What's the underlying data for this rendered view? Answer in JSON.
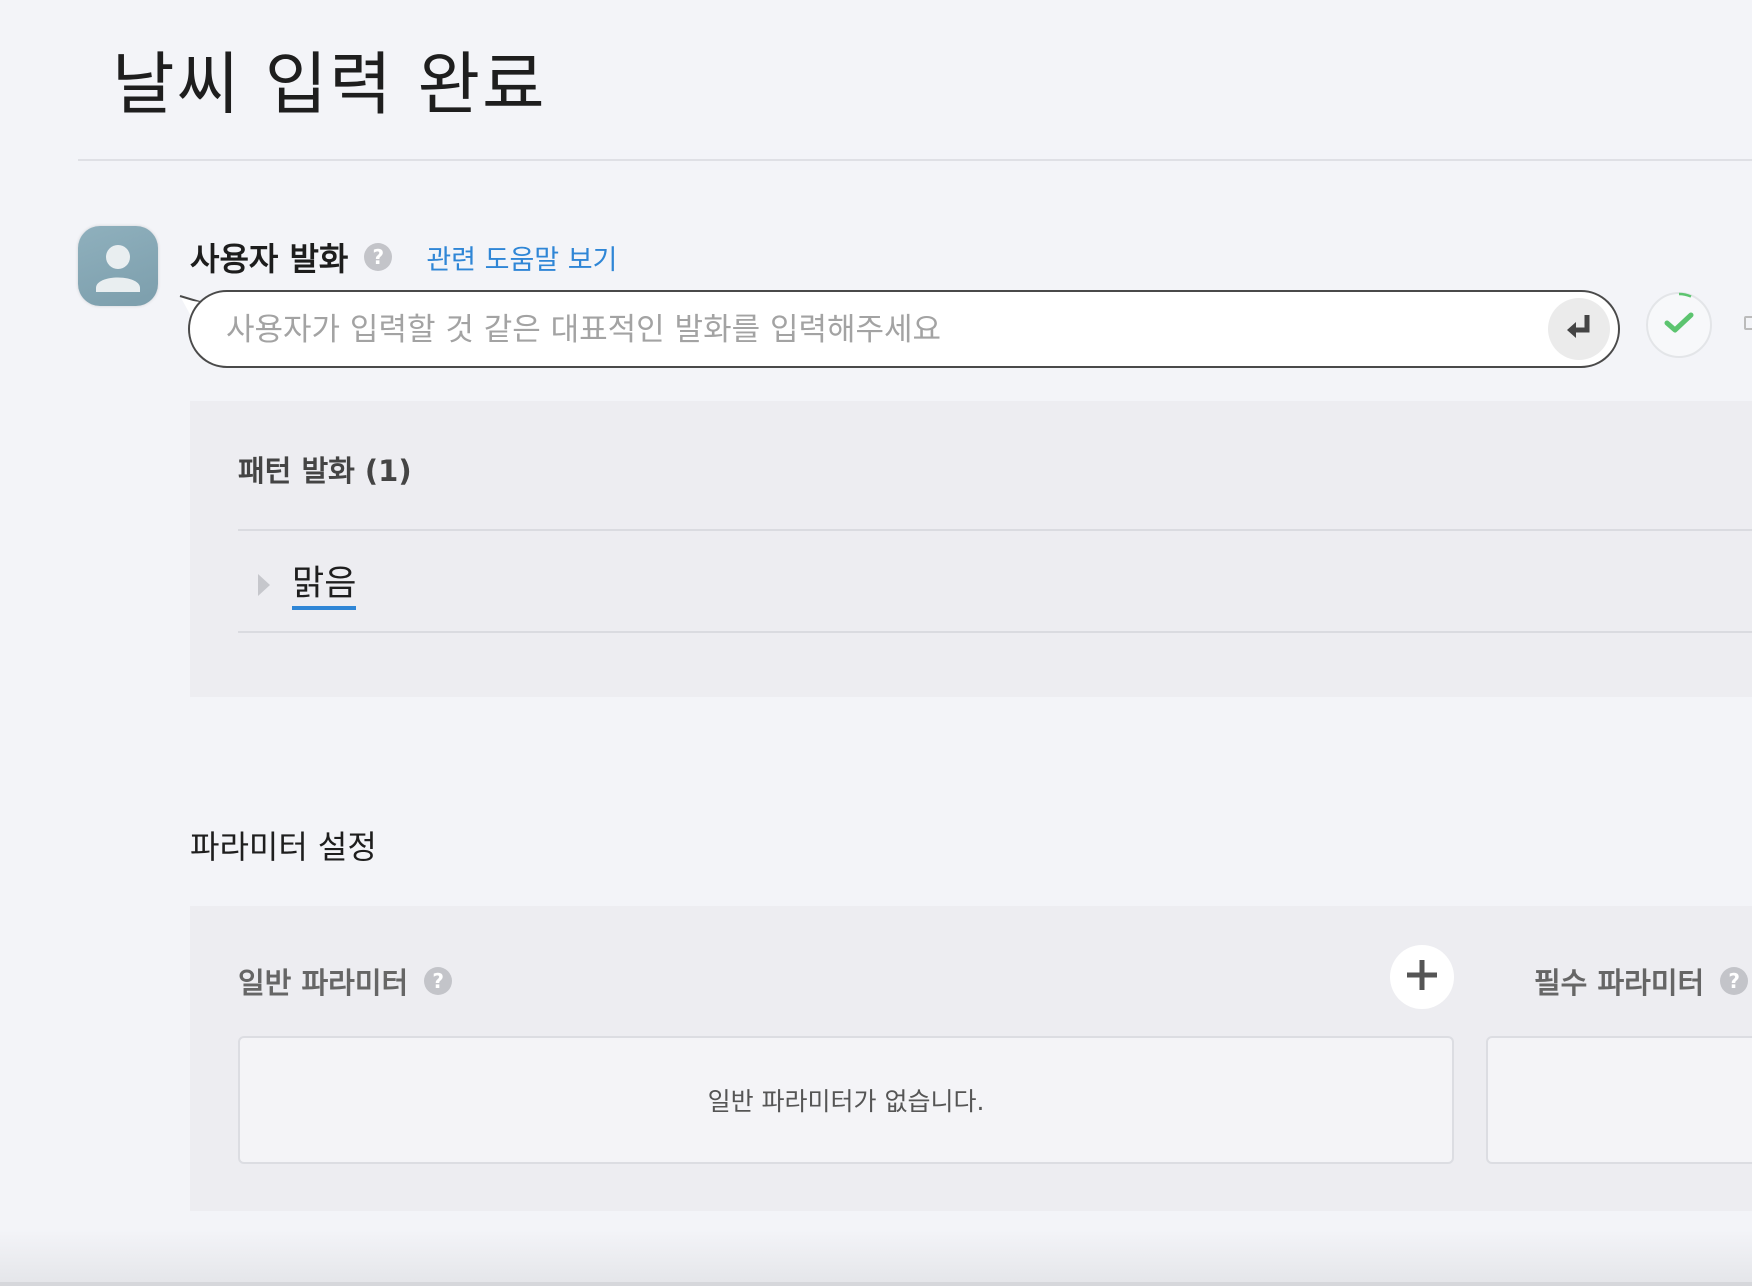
{
  "page": {
    "title": "날씨 입력 완료"
  },
  "utterance": {
    "label": "사용자 발화",
    "help_icon": "question-icon",
    "help_link": "관련 도움말 보기",
    "input_placeholder": "사용자가 입력할 것 같은 대표적인 발화를 입력해주세요",
    "input_value": "",
    "enter_icon": "enter-arrow-icon",
    "status_icon": "check-icon",
    "status_color": "#5cc46f"
  },
  "patterns": {
    "header": "패턴 발화 (1)",
    "items": [
      {
        "text": "맑음"
      }
    ]
  },
  "parameters": {
    "title": "파라미터 설정",
    "general": {
      "label": "일반 파라미터",
      "empty_text": "일반 파라미터가 없습니다.",
      "add_icon": "plus-icon"
    },
    "required": {
      "label": "필수 파라미터"
    }
  },
  "colors": {
    "accent": "#2f86d6",
    "background": "#f3f4f8",
    "panel": "#ededf1"
  }
}
